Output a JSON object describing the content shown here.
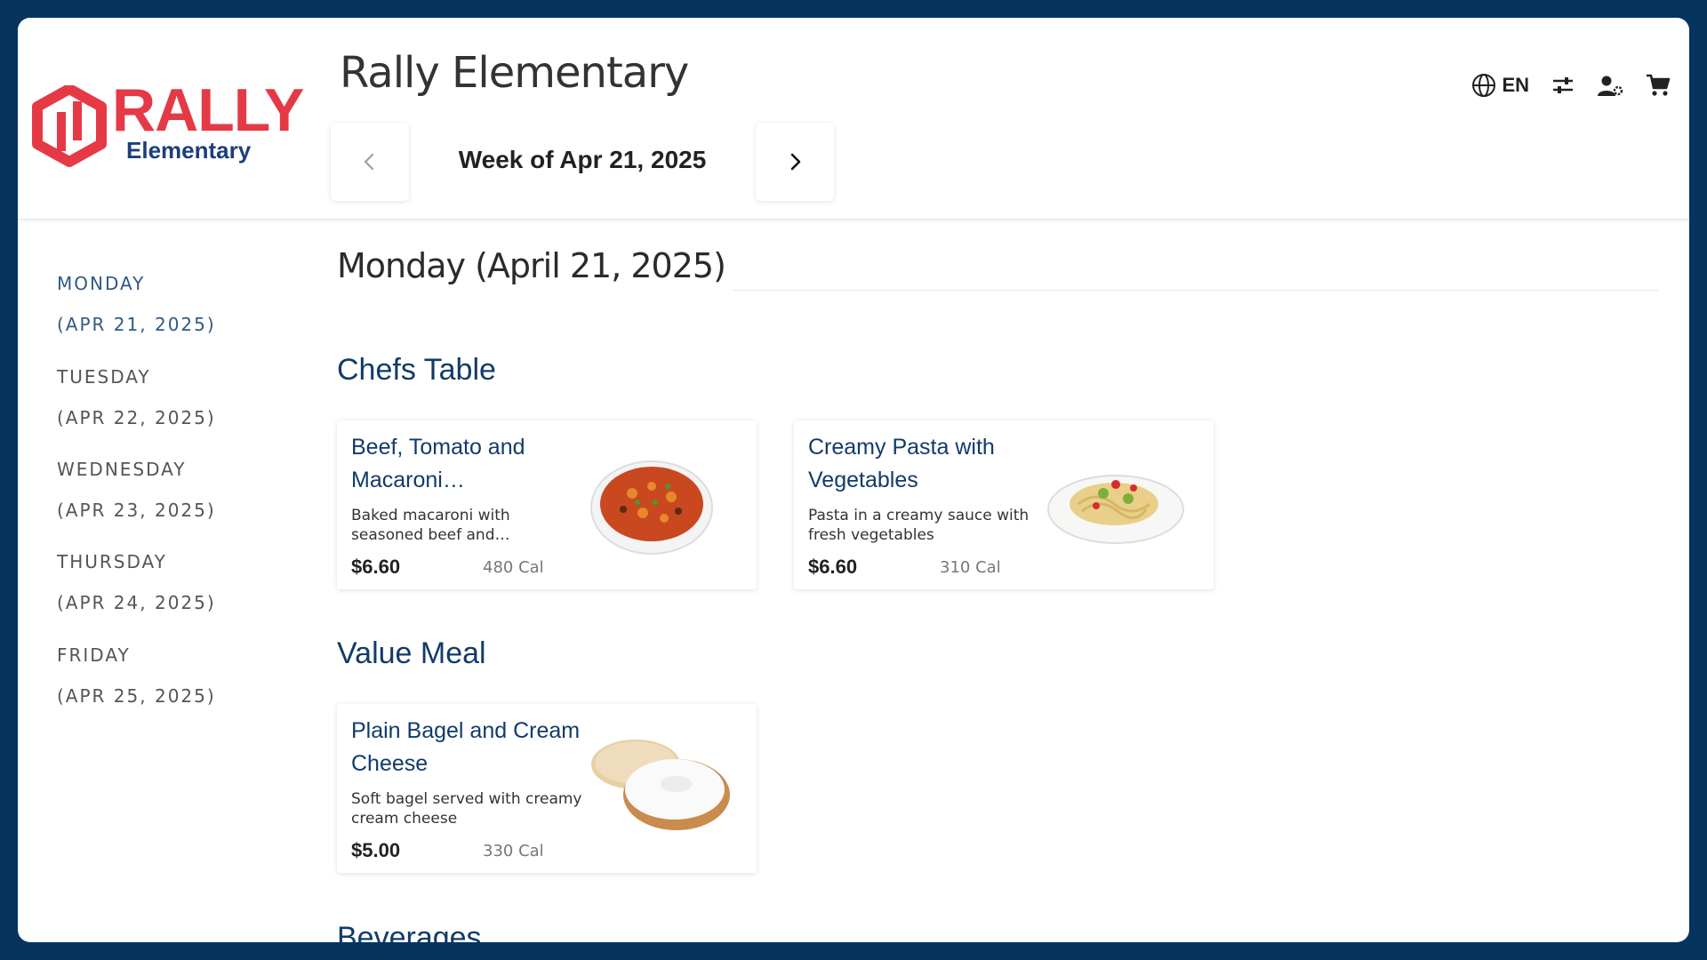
{
  "app": {
    "logo_text": "RALLY",
    "logo_sub": "Elementary",
    "title": "Rally Elementary"
  },
  "week": {
    "label": "Week of Apr 21, 2025",
    "prev_icon": "chevron-left-icon",
    "next_icon": "chevron-right-icon"
  },
  "toolbar": {
    "language_icon": "globe-icon",
    "language_code": "EN",
    "filter_icon": "sliders-icon",
    "account_icon": "user-settings-icon",
    "cart_icon": "cart-icon"
  },
  "sidebar": {
    "days": [
      {
        "name": "MONDAY",
        "date": "(APR 21, 2025)",
        "active": true
      },
      {
        "name": "TUESDAY",
        "date": "(APR 22, 2025)",
        "active": false
      },
      {
        "name": "WEDNESDAY",
        "date": "(APR 23, 2025)",
        "active": false
      },
      {
        "name": "THURSDAY",
        "date": "(APR 24, 2025)",
        "active": false
      },
      {
        "name": "FRIDAY",
        "date": "(APR 25, 2025)",
        "active": false
      }
    ]
  },
  "main": {
    "day_heading": "Monday (April 21, 2025)",
    "sections": [
      {
        "title": "Chefs Table",
        "items": [
          {
            "name": "Beef, Tomato and Macaroni…",
            "description": "Baked macaroni with seasoned beef and…",
            "price": "$6.60",
            "calories": "480 Cal",
            "image": "macaroni-bowl"
          },
          {
            "name": "Creamy Pasta with Vegetables",
            "description": "Pasta in a creamy sauce with fresh vegetables",
            "price": "$6.60",
            "calories": "310 Cal",
            "image": "pasta-plate"
          }
        ]
      },
      {
        "title": "Value Meal",
        "items": [
          {
            "name": "Plain Bagel and Cream Cheese",
            "description": "Soft bagel served with creamy cream cheese",
            "price": "$5.00",
            "calories": "330 Cal",
            "image": "bagel-cream-cheese"
          }
        ]
      },
      {
        "title": "Beverages",
        "items": []
      }
    ]
  },
  "colors": {
    "frame": "#05345f",
    "brand_red": "#e63946",
    "brand_navy": "#1c3f7a",
    "heading_blue": "#123b6a",
    "active_day": "#2f5a86"
  }
}
